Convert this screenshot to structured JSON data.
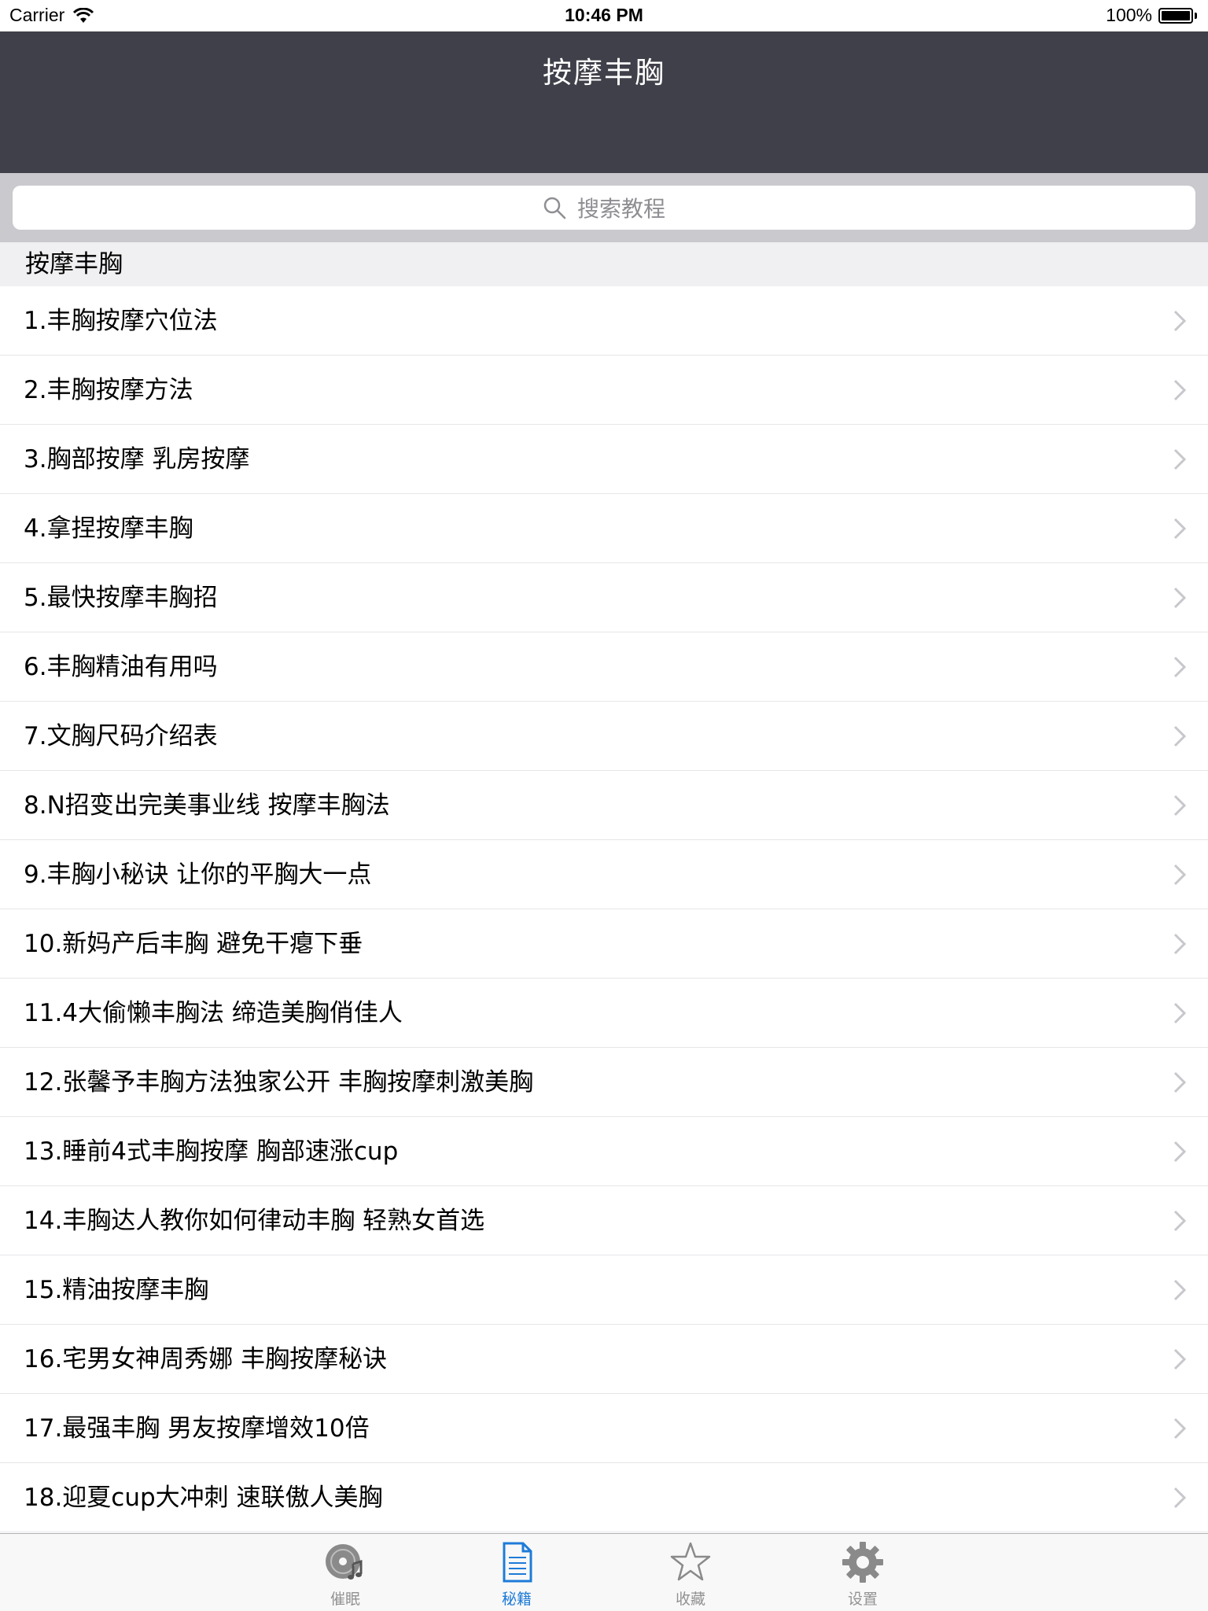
{
  "status_bar": {
    "carrier": "Carrier",
    "time": "10:46 PM",
    "battery": "100%"
  },
  "nav": {
    "title": "按摩丰胸"
  },
  "search": {
    "placeholder": "搜索教程"
  },
  "section": {
    "title": "按摩丰胸"
  },
  "items": [
    "1.丰胸按摩穴位法",
    "2.丰胸按摩方法",
    "3.胸部按摩 乳房按摩",
    "4.拿捏按摩丰胸",
    "5.最快按摩丰胸招",
    "6.丰胸精油有用吗",
    "7.文胸尺码介绍表",
    "8.N招变出完美事业线 按摩丰胸法",
    "9.丰胸小秘诀 让你的平胸大一点",
    "10.新妈产后丰胸 避免干瘪下垂",
    "11.4大偷懒丰胸法 缔造美胸俏佳人",
    "12.张馨予丰胸方法独家公开 丰胸按摩刺激美胸",
    "13.睡前4式丰胸按摩 胸部速涨cup",
    "14.丰胸达人教你如何律动丰胸 轻熟女首选",
    "15.精油按摩丰胸",
    "16.宅男女神周秀娜 丰胸按摩秘诀",
    "17.最强丰胸 男友按摩增效10倍",
    "18.迎夏cup大冲刺 速联傲人美胸"
  ],
  "tabs": [
    {
      "label": "催眠",
      "icon": "music-disc-icon"
    },
    {
      "label": "秘籍",
      "icon": "document-icon"
    },
    {
      "label": "收藏",
      "icon": "star-icon"
    },
    {
      "label": "设置",
      "icon": "gear-icon"
    }
  ],
  "colors": {
    "nav_bg": "#3f4049",
    "tab_active": "#1e7bd8",
    "tab_inactive": "#929292"
  }
}
